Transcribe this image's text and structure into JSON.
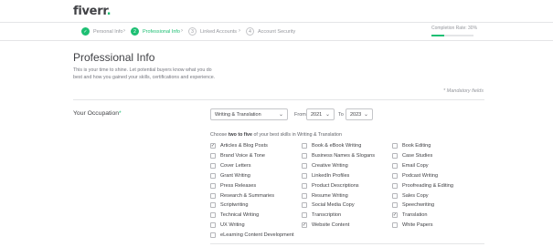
{
  "header": {
    "logo": "fiverr",
    "logo_dot": "."
  },
  "steps": [
    {
      "label": "Personal Info",
      "num": "✓"
    },
    {
      "label": "Professional Info",
      "num": "2"
    },
    {
      "label": "Linked Accounts",
      "num": "3"
    },
    {
      "label": "Account Security",
      "num": "4"
    }
  ],
  "completion": {
    "label": "Completion Rate: 30%",
    "value": 0.3
  },
  "page": {
    "title": "Professional Info",
    "intro": "This is your time to shine. Let potential buyers know what you do best and how you gained your skills, certifications and experience.",
    "mandatory": "* Mandatory fields"
  },
  "occupation": {
    "label": "Your Occupation",
    "required_mark": "*",
    "selected": "Writing & Translation",
    "from_label": "From",
    "from_value": "2021",
    "to_label": "To",
    "to_value": "2023",
    "choose_prefix": "Choose",
    "choose_bold": "two to five",
    "choose_suffix": "of your best skills in Writing & Translation"
  },
  "skills": {
    "col1": [
      {
        "label": "Articles & Blog Posts",
        "checked": true
      },
      {
        "label": "Brand Voice & Tone",
        "checked": false
      },
      {
        "label": "Cover Letters",
        "checked": false
      },
      {
        "label": "Grant Writing",
        "checked": false
      },
      {
        "label": "Press Releases",
        "checked": false
      },
      {
        "label": "Research & Summaries",
        "checked": false
      },
      {
        "label": "Scriptwriting",
        "checked": false
      },
      {
        "label": "Technical Writing",
        "checked": false
      },
      {
        "label": "UX Writing",
        "checked": false
      },
      {
        "label": "eLearning Content Development",
        "checked": false
      }
    ],
    "col2": [
      {
        "label": "Book & eBook Writing",
        "checked": false
      },
      {
        "label": "Business Names & Slogans",
        "checked": false
      },
      {
        "label": "Creative Writing",
        "checked": false
      },
      {
        "label": "LinkedIn Profiles",
        "checked": false
      },
      {
        "label": "Product Descriptions",
        "checked": false
      },
      {
        "label": "Resume Writing",
        "checked": false
      },
      {
        "label": "Social Media Copy",
        "checked": false
      },
      {
        "label": "Transcription",
        "checked": false
      },
      {
        "label": "Website Content",
        "checked": true
      }
    ],
    "col3": [
      {
        "label": "Book Editing",
        "checked": false
      },
      {
        "label": "Case Studies",
        "checked": false
      },
      {
        "label": "Email Copy",
        "checked": false
      },
      {
        "label": "Podcast Writing",
        "checked": false
      },
      {
        "label": "Proofreading & Editing",
        "checked": false
      },
      {
        "label": "Sales Copy",
        "checked": false
      },
      {
        "label": "Speechwriting",
        "checked": false
      },
      {
        "label": "Translation",
        "checked": true
      },
      {
        "label": "White Papers",
        "checked": false
      }
    ]
  },
  "colors": {
    "accent": "#1dbf73",
    "text": "#404145",
    "muted": "#95979d"
  }
}
